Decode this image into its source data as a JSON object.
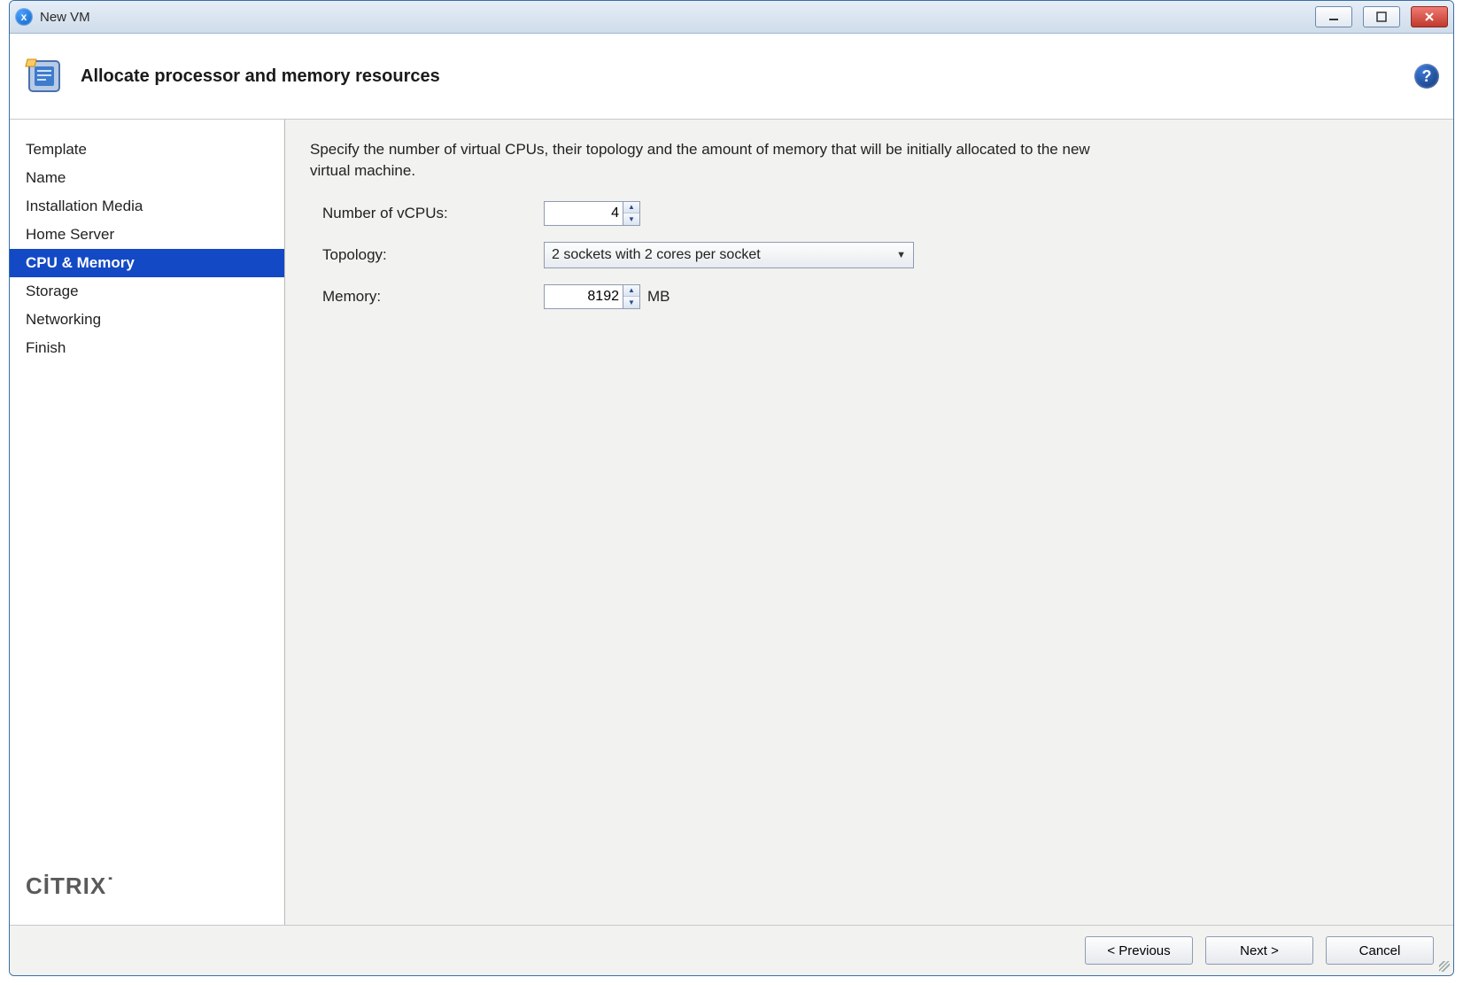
{
  "window": {
    "title": "New VM"
  },
  "header": {
    "title": "Allocate processor and memory resources"
  },
  "sidebar": {
    "items": [
      {
        "label": "Template",
        "active": false
      },
      {
        "label": "Name",
        "active": false
      },
      {
        "label": "Installation Media",
        "active": false
      },
      {
        "label": "Home Server",
        "active": false
      },
      {
        "label": "CPU & Memory",
        "active": true
      },
      {
        "label": "Storage",
        "active": false
      },
      {
        "label": "Networking",
        "active": false
      },
      {
        "label": "Finish",
        "active": false
      }
    ],
    "brand": "CİTRIX"
  },
  "content": {
    "description": "Specify the number of virtual CPUs, their topology and the amount of memory that will be initially allocated to the new virtual machine.",
    "vcpu": {
      "label": "Number of vCPUs:",
      "value": "4"
    },
    "topology": {
      "label": "Topology:",
      "value": "2 sockets with 2 cores per socket"
    },
    "memory": {
      "label": "Memory:",
      "value": "8192",
      "unit": "MB"
    }
  },
  "footer": {
    "previous": "< Previous",
    "next": "Next >",
    "cancel": "Cancel"
  }
}
